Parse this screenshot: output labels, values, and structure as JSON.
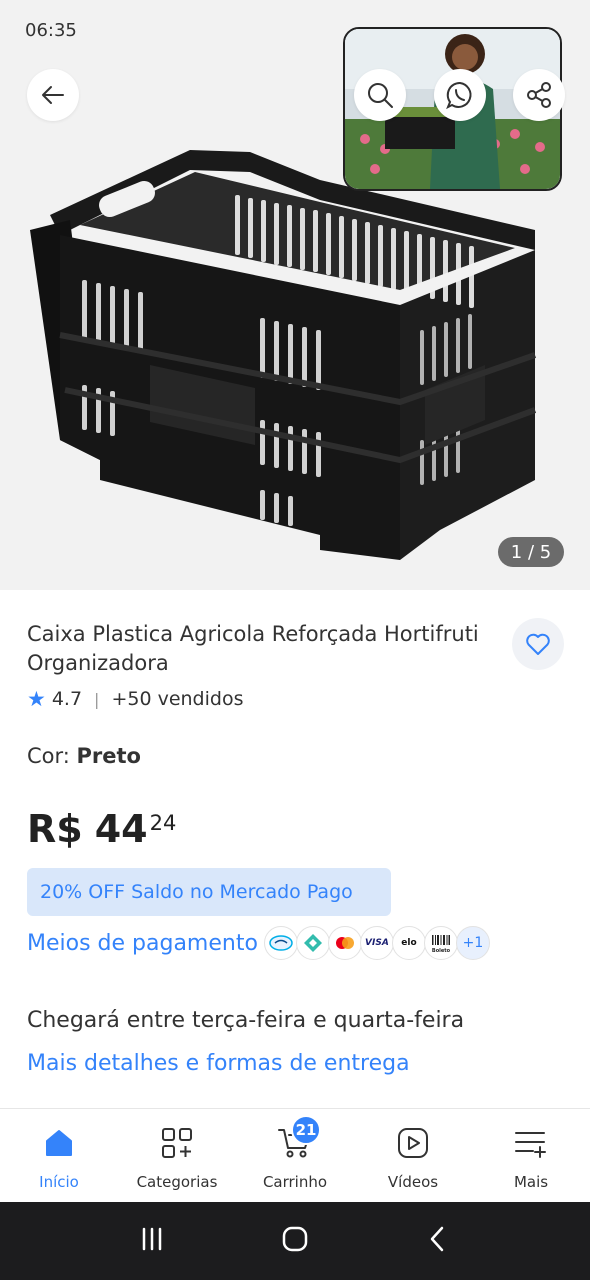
{
  "status": {
    "time": "06:35"
  },
  "gallery": {
    "counter": "1 / 5"
  },
  "product": {
    "title": "Caixa Plastica Agricola Reforçada Hortifruti Organizadora",
    "rating": "4.7",
    "sold": "+50 vendidos",
    "color_label": "Cor: ",
    "color_value": "Preto",
    "price_currency": "R$",
    "price_whole": "44",
    "price_cents": "24"
  },
  "promo": {
    "discount": "20% OFF Saldo no Mercado Pago"
  },
  "payment": {
    "link": "Meios de pagamento",
    "icons": [
      "mercadopago-icon",
      "pix-icon",
      "mastercard-icon",
      "visa-icon",
      "elo-icon",
      "boleto-icon"
    ],
    "visa_label": "VISA",
    "elo_label": "elo",
    "boleto_label": "Boleto",
    "more": "+1"
  },
  "delivery": {
    "text": "Chegará entre terça-feira e quarta-feira",
    "link": "Mais detalhes e formas de entrega"
  },
  "bottom_nav": {
    "items": [
      {
        "label": "Início",
        "icon": "home-icon"
      },
      {
        "label": "Categorias",
        "icon": "grid-plus-icon"
      },
      {
        "label": "Carrinho",
        "icon": "cart-icon",
        "badge": "21"
      },
      {
        "label": "Vídeos",
        "icon": "play-icon"
      },
      {
        "label": "Mais",
        "icon": "menu-plus-icon"
      }
    ]
  },
  "colors": {
    "accent": "#3483fa",
    "discount_bg": "#d9e7fa",
    "hero_bg": "#f2f2f2"
  }
}
